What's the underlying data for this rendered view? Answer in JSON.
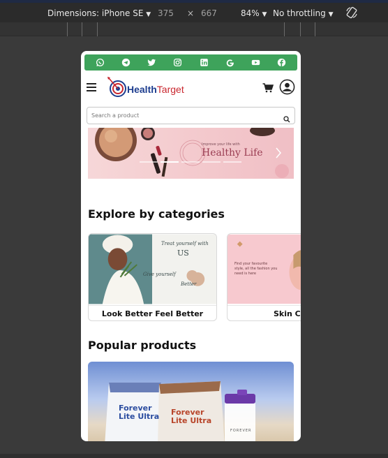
{
  "devtools": {
    "dimensions_label": "Dimensions: iPhone SE",
    "width": "375",
    "times": "×",
    "height": "667",
    "zoom": "84%",
    "throttling": "No throttling",
    "rotate_icon": "rotate-icon"
  },
  "social": {
    "icons": [
      "whatsapp-icon",
      "telegram-icon",
      "twitter-icon",
      "instagram-icon",
      "linkedin-icon",
      "google-icon",
      "youtube-icon",
      "facebook-icon"
    ],
    "bar_color": "#3ea35b"
  },
  "header": {
    "logo_part1": "Health",
    "logo_part2": "Target",
    "cart_icon": "cart-icon",
    "profile_icon": "profile-icon"
  },
  "search": {
    "placeholder": "Search a product"
  },
  "banner": {
    "small_text": "Improve your life with",
    "big_text": "Healthy Life",
    "active_slide": 2,
    "slide_count": 5
  },
  "categories": {
    "title": "Explore by categories",
    "items": [
      {
        "label": "Look Better Feel Better",
        "script_line1": "Treat yourself with",
        "script_line2": "US",
        "script_line3": "Give yourself",
        "script_line4": "Better"
      },
      {
        "label": "Skin C",
        "promo_text": "Find your favourite style, all the fashion you need is here"
      }
    ]
  },
  "products": {
    "title": "Popular products",
    "items": [
      {
        "brand_line1": "Forever",
        "brand_line2": "Lite Ultra",
        "shaker_text": "FOREVER"
      }
    ]
  }
}
